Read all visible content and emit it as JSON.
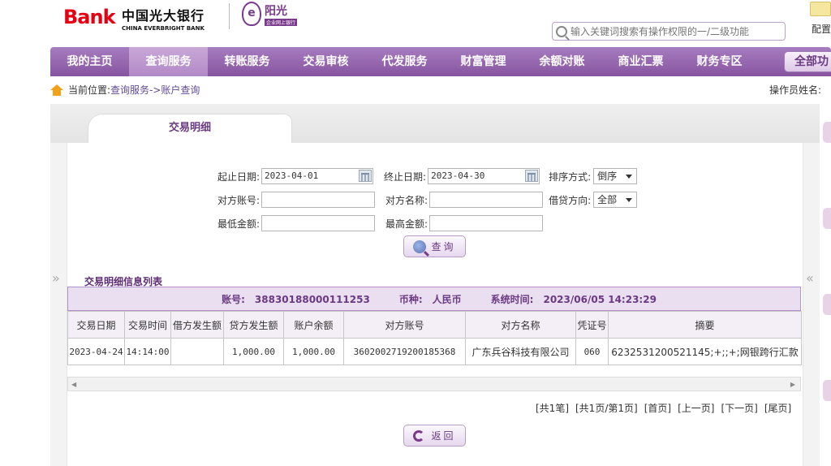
{
  "header": {
    "bank_logo_b": "B",
    "bank_logo_rest": "ank",
    "bank_name_cn": "中国光大银行",
    "bank_name_en": "CHINA EVERBRIGHT BANK",
    "sub_logo_emblem": "e",
    "sub_logo_title": "阳光",
    "sub_logo_subtitle": "企业网上银行",
    "search_placeholder": "输入关键词搜索有操作权限的一/二级功能",
    "config_label": "配置"
  },
  "nav": {
    "items": [
      {
        "label": "我的主页"
      },
      {
        "label": "查询服务",
        "active": true
      },
      {
        "label": "转账服务"
      },
      {
        "label": "交易审核"
      },
      {
        "label": "代发服务"
      },
      {
        "label": "财富管理"
      },
      {
        "label": "余额对账"
      },
      {
        "label": "商业汇票"
      },
      {
        "label": "财务专区"
      }
    ],
    "all_functions": "全部功"
  },
  "breadcrumb": {
    "label": "当前位置:",
    "path": "查询服务->账户查询",
    "operator_label": "操作员姓名:"
  },
  "tab": {
    "title": "交易明细"
  },
  "form": {
    "start_date_label": "起止日期:",
    "start_date_value": "2023-04-01",
    "end_date_label": "终止日期:",
    "end_date_value": "2023-04-30",
    "sort_label": "排序方式:",
    "sort_value": "倒序",
    "counter_account_label": "对方账号:",
    "counter_account_value": "",
    "counter_name_label": "对方名称:",
    "counter_name_value": "",
    "direction_label": "借贷方向:",
    "direction_value": "全部",
    "min_amount_label": "最低金额:",
    "min_amount_value": "",
    "max_amount_label": "最高金额:",
    "max_amount_value": "",
    "query_button": "查询"
  },
  "list": {
    "title": "交易明细信息列表",
    "account_label": "账号:",
    "account_value": "38830188000111253",
    "currency_label": "币种:",
    "currency_value": "人民币",
    "system_time_label": "系统时间:",
    "system_time_value": "2023/06/05 14:23:29",
    "columns": [
      "交易日期",
      "交易时间",
      "借方发生额",
      "贷方发生额",
      "账户余额",
      "对方账号",
      "对方名称",
      "凭证号",
      "摘要"
    ],
    "rows": [
      [
        "2023-04-24",
        "14:14:00",
        "",
        "1,000.00",
        "1,000.00",
        "3602002719200185368",
        "广东兵谷科技有限公司",
        "060",
        "6232531200521145;+;;+;网银跨行汇款"
      ]
    ]
  },
  "pager": {
    "total": "[共1笔]",
    "pages": "[共1页/第1页]",
    "first": "[首页]",
    "prev": "[上一页]",
    "next": "[下一页]",
    "last": "[尾页]"
  },
  "back_button": "返回"
}
